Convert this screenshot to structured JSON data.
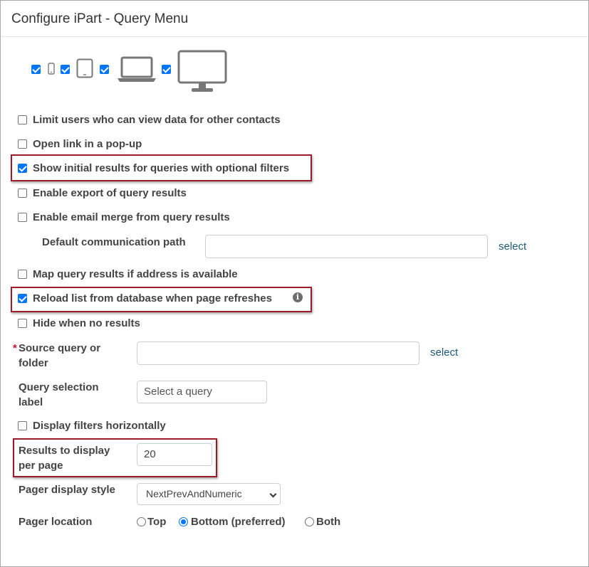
{
  "dialog": {
    "title": "Configure iPart - Query Menu"
  },
  "options": {
    "limit_users": "Limit users who can view data for other contacts",
    "open_popup": "Open link in a pop-up",
    "show_initial": "Show initial results for queries with optional filters",
    "enable_export": "Enable export of query results",
    "enable_email_merge": "Enable email merge from query results",
    "map_results": "Map query results if address is available",
    "reload_list": "Reload list from database when page refreshes",
    "hide_no_results": "Hide when no results",
    "display_filters": "Display filters horizontally"
  },
  "fields": {
    "default_comm_path_label": "Default communication path",
    "default_comm_path_value": "",
    "source_query_required": "*",
    "source_query_label_line1": "Source query or",
    "source_query_label_line2": "folder",
    "source_query_value": "",
    "select_link": "select",
    "query_selection_label_line1": "Query selection",
    "query_selection_label_line2": "label",
    "query_selection_placeholder": "Select a query",
    "results_per_page_label_line1": "Results to display",
    "results_per_page_label_line2": "per page",
    "results_per_page_value": "20",
    "pager_style_label": "Pager display style",
    "pager_style_value": "NextPrevAndNumeric",
    "pager_location_label": "Pager location",
    "pager_location_options": [
      "Top",
      "Bottom (preferred)",
      "Both"
    ],
    "pager_location_selected": "Bottom (preferred)"
  },
  "icons": {
    "phone": "phone-icon",
    "tablet": "tablet-icon",
    "laptop": "laptop-icon",
    "desktop": "desktop-icon",
    "info": "info-icon"
  },
  "colors": {
    "highlight": "#9c1b2b",
    "checkbox": "#0075ff",
    "link": "#1d5b79"
  }
}
